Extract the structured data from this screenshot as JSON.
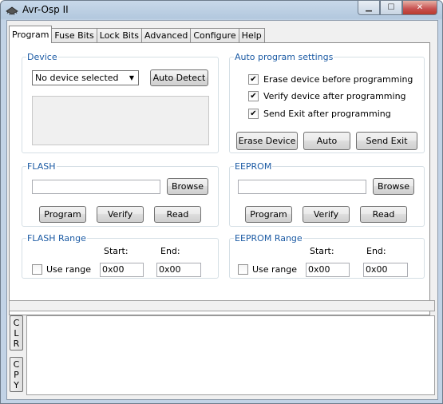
{
  "window": {
    "title": "Avr-Osp II"
  },
  "tabs": [
    {
      "label": "Program",
      "active": true
    },
    {
      "label": "Fuse Bits"
    },
    {
      "label": "Lock Bits"
    },
    {
      "label": "Advanced"
    },
    {
      "label": "Configure"
    },
    {
      "label": "Help"
    }
  ],
  "device": {
    "legend": "Device",
    "selected": "No device selected",
    "auto_detect": "Auto Detect"
  },
  "auto_program": {
    "legend": "Auto program settings",
    "options": [
      {
        "label": "Erase device before programming",
        "checked": true
      },
      {
        "label": "Verify device after programming",
        "checked": true
      },
      {
        "label": "Send Exit after programming",
        "checked": true
      }
    ],
    "erase_device": "Erase Device",
    "auto": "Auto",
    "send_exit": "Send Exit"
  },
  "flash": {
    "legend": "FLASH",
    "path_value": "",
    "browse": "Browse",
    "program": "Program",
    "verify": "Verify",
    "read": "Read"
  },
  "eeprom": {
    "legend": "EEPROM",
    "path_value": "",
    "browse": "Browse",
    "program": "Program",
    "verify": "Verify",
    "read": "Read"
  },
  "flash_range": {
    "legend": "FLASH Range",
    "start_label": "Start:",
    "end_label": "End:",
    "use_range": "Use range",
    "use_range_checked": false,
    "start": "0x00",
    "end": "0x00"
  },
  "eeprom_range": {
    "legend": "EEPROM Range",
    "start_label": "Start:",
    "end_label": "End:",
    "use_range": "Use range",
    "use_range_checked": false,
    "start": "0x00",
    "end": "0x00"
  },
  "side_buttons": {
    "clear": "C\nL\nR",
    "copy": "C\nP\nY"
  },
  "log": {
    "text": ""
  },
  "check_mark": "✔",
  "icons": {
    "minimize": "minimize-icon",
    "maximize": "maximize-icon",
    "close": "close-icon",
    "app": "chip-icon"
  }
}
